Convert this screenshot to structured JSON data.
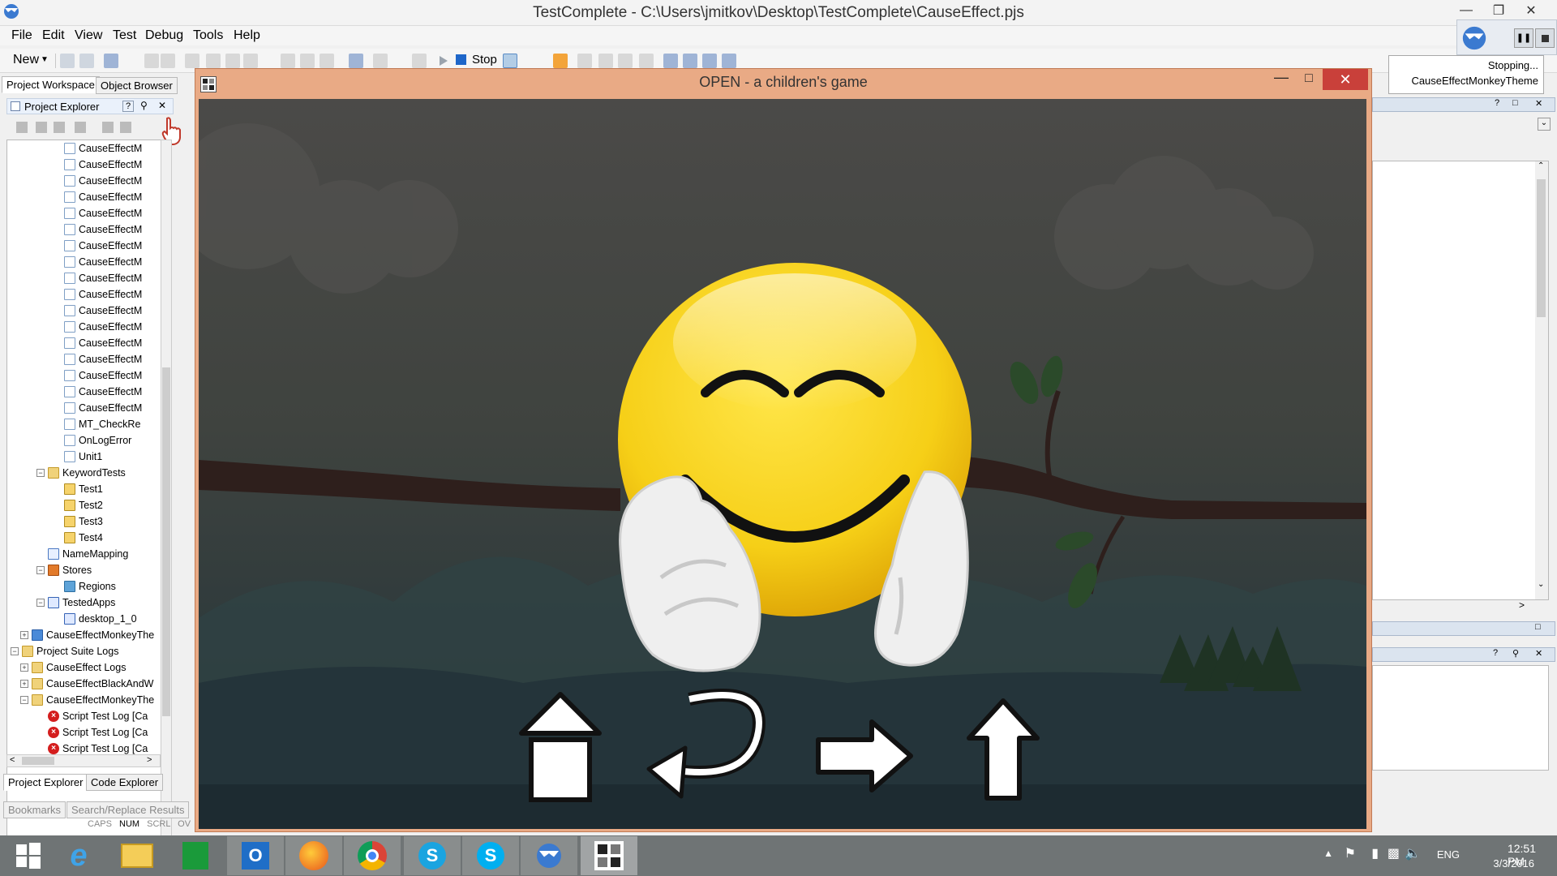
{
  "app": {
    "title": "TestComplete - C:\\Users\\jmitkov\\Desktop\\TestComplete\\CauseEffect.pjs"
  },
  "menu": {
    "items": [
      "File",
      "Edit",
      "View",
      "Test",
      "Debug",
      "Tools",
      "Help"
    ]
  },
  "toolbar": {
    "new_label": "New",
    "stop_label": "Stop"
  },
  "monkey_popup": {
    "status": "Stopping...",
    "theme": "CauseEffectMonkeyTheme"
  },
  "left_panel": {
    "tabs": [
      "Project Workspace",
      "Object Browser"
    ],
    "header": "Project Explorer",
    "bottom_tabs": [
      "Project Explorer",
      "Code Explorer"
    ],
    "tree": [
      {
        "label": "CauseEffectM",
        "icon": "script-icon",
        "level": 3
      },
      {
        "label": "CauseEffectM",
        "icon": "script-icon",
        "level": 3
      },
      {
        "label": "CauseEffectM",
        "icon": "script-icon",
        "level": 3
      },
      {
        "label": "CauseEffectM",
        "icon": "script-icon",
        "level": 3
      },
      {
        "label": "CauseEffectM",
        "icon": "script-icon",
        "level": 3
      },
      {
        "label": "CauseEffectM",
        "icon": "script-icon",
        "level": 3
      },
      {
        "label": "CauseEffectM",
        "icon": "script-icon",
        "level": 3
      },
      {
        "label": "CauseEffectM",
        "icon": "script-icon",
        "level": 3
      },
      {
        "label": "CauseEffectM",
        "icon": "script-icon",
        "level": 3
      },
      {
        "label": "CauseEffectM",
        "icon": "script-icon",
        "level": 3
      },
      {
        "label": "CauseEffectM",
        "icon": "script-icon",
        "level": 3
      },
      {
        "label": "CauseEffectM",
        "icon": "script-icon",
        "level": 3
      },
      {
        "label": "CauseEffectM",
        "icon": "script-icon",
        "level": 3
      },
      {
        "label": "CauseEffectM",
        "icon": "script-icon",
        "level": 3
      },
      {
        "label": "CauseEffectM",
        "icon": "script-icon",
        "level": 3
      },
      {
        "label": "CauseEffectM",
        "icon": "script-icon",
        "level": 3
      },
      {
        "label": "CauseEffectM",
        "icon": "script-icon",
        "level": 3
      },
      {
        "label": "MT_CheckRe",
        "icon": "script-icon",
        "level": 3
      },
      {
        "label": "OnLogError",
        "icon": "script-icon",
        "level": 3
      },
      {
        "label": "Unit1",
        "icon": "script-icon",
        "level": 3
      },
      {
        "label": "KeywordTests",
        "icon": "keyword-folder-icon",
        "level": 2,
        "expander": "−"
      },
      {
        "label": "Test1",
        "icon": "keyword-test-icon",
        "level": 3
      },
      {
        "label": "Test2",
        "icon": "keyword-test-icon",
        "level": 3
      },
      {
        "label": "Test3",
        "icon": "keyword-test-icon",
        "level": 3
      },
      {
        "label": "Test4",
        "icon": "keyword-test-icon",
        "level": 3
      },
      {
        "label": "NameMapping",
        "icon": "name-mapping-icon",
        "level": 2
      },
      {
        "label": "Stores",
        "icon": "stores-icon",
        "level": 2,
        "expander": "−"
      },
      {
        "label": "Regions",
        "icon": "regions-icon",
        "level": 3
      },
      {
        "label": "TestedApps",
        "icon": "tested-apps-icon",
        "level": 2,
        "expander": "−"
      },
      {
        "label": "desktop_1_0",
        "icon": "app-icon",
        "level": 3
      },
      {
        "label": "CauseEffectMonkeyThe",
        "icon": "monkey-project-icon",
        "level": 1,
        "expander": "+"
      },
      {
        "label": "Project Suite Logs",
        "icon": "log-folder-icon",
        "level": 0,
        "expander": "−"
      },
      {
        "label": "CauseEffect Logs",
        "icon": "log-folder-icon",
        "level": 1,
        "expander": "+"
      },
      {
        "label": "CauseEffectBlackAndW",
        "icon": "log-folder-icon",
        "level": 1,
        "expander": "+"
      },
      {
        "label": "CauseEffectMonkeyThe",
        "icon": "log-folder-icon",
        "level": 1,
        "expander": "−"
      },
      {
        "label": "Script Test Log [Ca",
        "icon": "error-icon",
        "level": 2
      },
      {
        "label": "Script Test Log [Ca",
        "icon": "error-icon",
        "level": 2
      },
      {
        "label": "Script Test Log [Ca",
        "icon": "error-icon",
        "level": 2
      }
    ]
  },
  "bottom_bar": {
    "tabs": [
      "Bookmarks",
      "Search/Replace Results"
    ],
    "status": [
      "CAPS",
      "NUM",
      "SCRL",
      "OV"
    ]
  },
  "game": {
    "title": "OPEN - a children's game",
    "controls": [
      "home-icon",
      "undo-icon",
      "forward-arrow-icon",
      "up-arrow-icon"
    ]
  },
  "taskbar": {
    "apps": [
      "start-icon",
      "internet-explorer-icon",
      "file-explorer-icon",
      "store-icon",
      "outlook-icon",
      "firefox-icon",
      "chrome-icon",
      "skype-business-icon",
      "skype-icon",
      "testcomplete-icon",
      "open-game-icon"
    ],
    "language": "ENG",
    "time": "12:51 PM",
    "date": "3/3/2016"
  }
}
